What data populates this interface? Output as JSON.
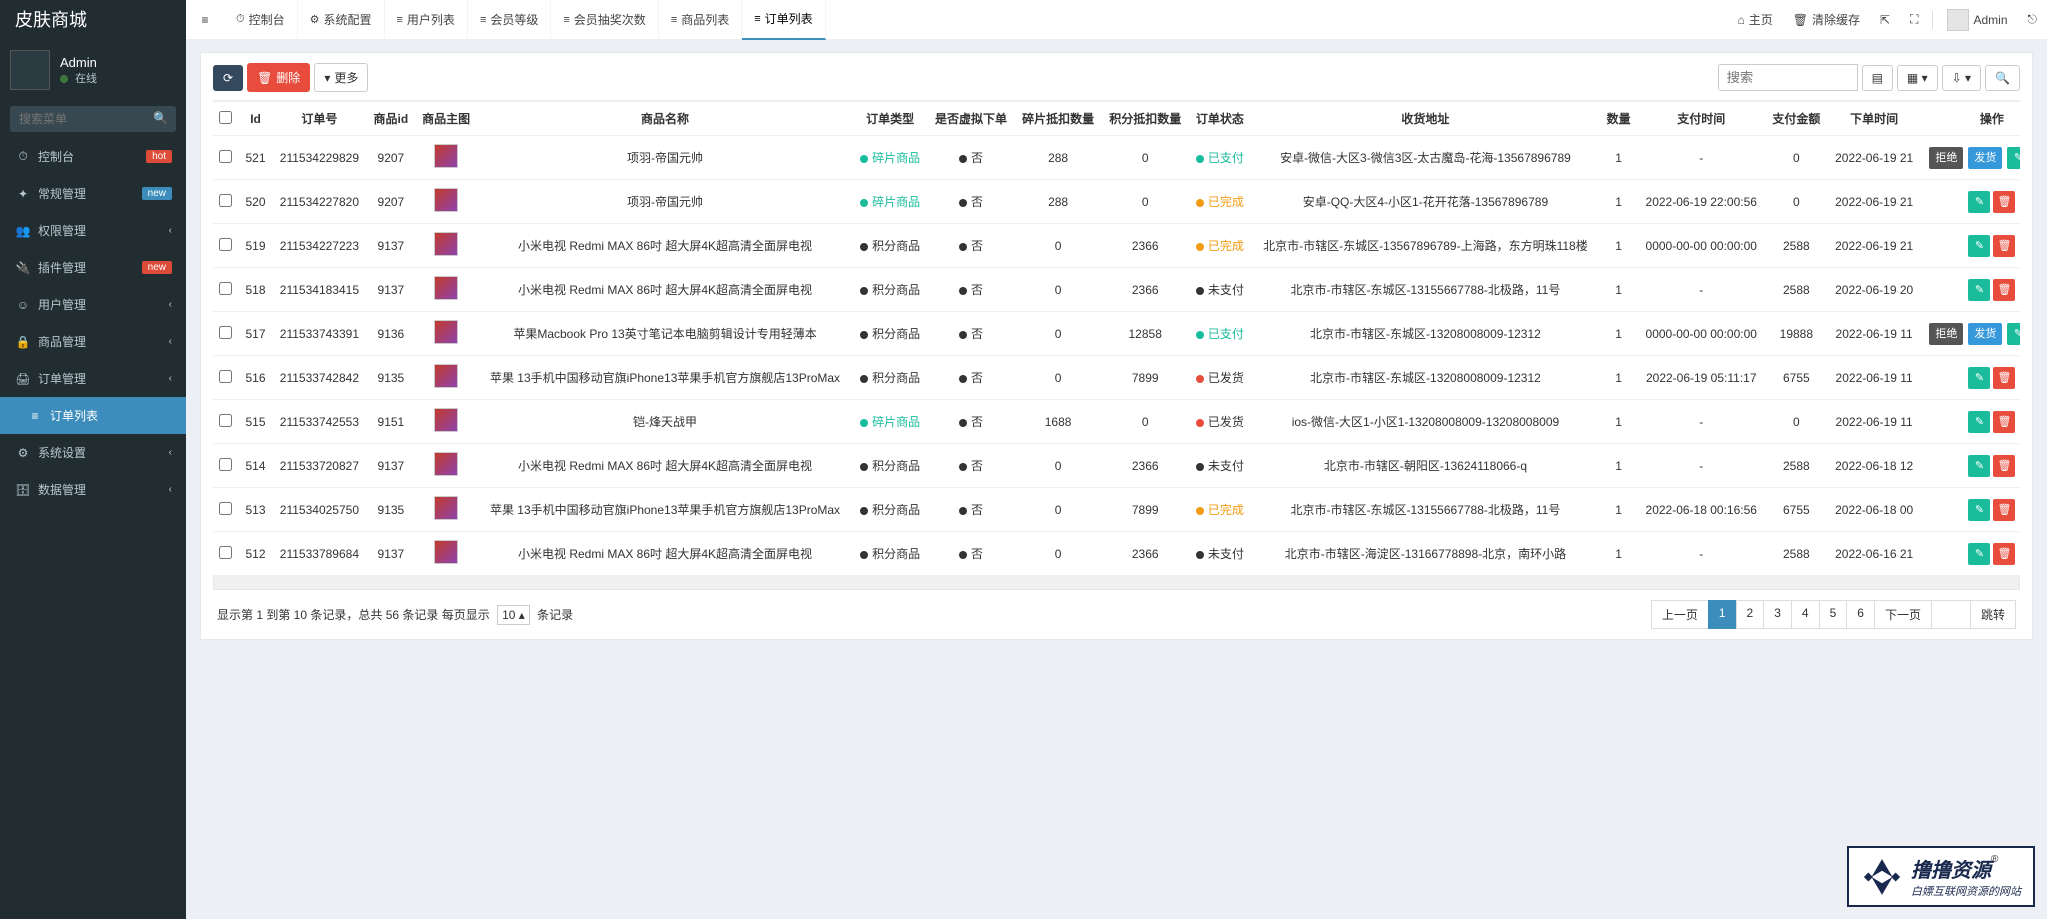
{
  "brand": "皮肤商城",
  "user": {
    "name": "Admin",
    "status": "在线"
  },
  "sidebar": {
    "search_placeholder": "搜索菜单",
    "items": [
      {
        "icon": "⏱",
        "label": "控制台",
        "badge": "hot",
        "badgeClass": "bdg-hot"
      },
      {
        "icon": "✦",
        "label": "常规管理",
        "badge": "new",
        "badgeClass": "bdg-new"
      },
      {
        "icon": "👥",
        "label": "权限管理",
        "caret": true
      },
      {
        "icon": "🔌",
        "label": "插件管理",
        "badge": "new",
        "badgeClass": "bdg-hot"
      },
      {
        "icon": "☺",
        "label": "用户管理",
        "caret": true
      },
      {
        "icon": "🔒",
        "label": "商品管理",
        "caret": true
      },
      {
        "icon": "🖨",
        "label": "订单管理",
        "caret": true,
        "sub": [
          {
            "icon": "≡",
            "label": "订单列表",
            "active": true
          }
        ]
      },
      {
        "icon": "⚙",
        "label": "系统设置",
        "caret": true
      },
      {
        "icon": "🗄",
        "label": "数据管理",
        "caret": true
      }
    ]
  },
  "tabs": [
    {
      "icon": "⏱",
      "label": "控制台"
    },
    {
      "icon": "⚙",
      "label": "系统配置"
    },
    {
      "icon": "≡",
      "label": "用户列表"
    },
    {
      "icon": "≡",
      "label": "会员等级"
    },
    {
      "icon": "≡",
      "label": "会员抽奖次数"
    },
    {
      "icon": "≡",
      "label": "商品列表"
    },
    {
      "icon": "≡",
      "label": "订单列表",
      "active": true
    }
  ],
  "topRight": {
    "home": "主页",
    "clear": "清除缓存",
    "admin": "Admin"
  },
  "toolbar": {
    "refresh": "⟳",
    "delete": "删除",
    "more": "更多",
    "search_placeholder": "搜索"
  },
  "columns": [
    "",
    "Id",
    "订单号",
    "商品id",
    "商品主图",
    "商品名称",
    "订单类型",
    "是否虚拟下单",
    "碎片抵扣数量",
    "积分抵扣数量",
    "订单状态",
    "收货地址",
    "数量",
    "支付时间",
    "支付金额",
    "下单时间",
    "操作"
  ],
  "orderTypes": {
    "frag": "碎片商品",
    "points": "积分商品"
  },
  "statuses": {
    "paid": {
      "label": "已支付",
      "dot": "dot-green",
      "txt": "txt-green"
    },
    "done": {
      "label": "已完成",
      "dot": "dot-orange",
      "txt": "txt-orange"
    },
    "unpaid": {
      "label": "未支付",
      "dot": "dot-black",
      "txt": "txt-black"
    },
    "shipped": {
      "label": "已发货",
      "dot": "dot-red",
      "txt": "txt-black"
    }
  },
  "actionTags": {
    "reject": "拒绝",
    "ship": "发货"
  },
  "noValue": "否",
  "dash": "-",
  "rows": [
    {
      "id": "521",
      "order": "211534229829",
      "gid": "9207",
      "name": "项羽-帝国元帅",
      "type": "frag",
      "virtual": "否",
      "frag": "288",
      "pts": "0",
      "status": "paid",
      "addr": "安卓-微信-大区3-微信3区-太古魔岛-花海-13567896789",
      "qty": "1",
      "paytime": "-",
      "payamt": "0",
      "ordertime": "2022-06-19 21",
      "tags": [
        "reject",
        "ship"
      ]
    },
    {
      "id": "520",
      "order": "211534227820",
      "gid": "9207",
      "name": "项羽-帝国元帅",
      "type": "frag",
      "virtual": "否",
      "frag": "288",
      "pts": "0",
      "status": "done",
      "addr": "安卓-QQ-大区4-小区1-花开花落-13567896789",
      "qty": "1",
      "paytime": "2022-06-19 22:00:56",
      "payamt": "0",
      "ordertime": "2022-06-19 21",
      "tags": []
    },
    {
      "id": "519",
      "order": "211534227223",
      "gid": "9137",
      "name": "小米电视 Redmi MAX 86吋 超大屏4K超高清全面屏电视",
      "type": "points",
      "virtual": "否",
      "frag": "0",
      "pts": "2366",
      "status": "done",
      "addr": "北京市-市辖区-东城区-13567896789-上海路，东方明珠118楼",
      "qty": "1",
      "paytime": "0000-00-00 00:00:00",
      "payamt": "2588",
      "ordertime": "2022-06-19 21",
      "tags": []
    },
    {
      "id": "518",
      "order": "211534183415",
      "gid": "9137",
      "name": "小米电视 Redmi MAX 86吋 超大屏4K超高清全面屏电视",
      "type": "points",
      "virtual": "否",
      "frag": "0",
      "pts": "2366",
      "status": "unpaid",
      "addr": "北京市-市辖区-东城区-13155667788-北极路，11号",
      "qty": "1",
      "paytime": "-",
      "payamt": "2588",
      "ordertime": "2022-06-19 20",
      "tags": []
    },
    {
      "id": "517",
      "order": "211533743391",
      "gid": "9136",
      "name": "苹果Macbook Pro 13英寸笔记本电脑剪辑设计专用轻薄本",
      "type": "points",
      "virtual": "否",
      "frag": "0",
      "pts": "12858",
      "status": "paid",
      "addr": "北京市-市辖区-东城区-13208008009-12312",
      "qty": "1",
      "paytime": "0000-00-00 00:00:00",
      "payamt": "19888",
      "ordertime": "2022-06-19 11",
      "tags": [
        "reject",
        "ship"
      ]
    },
    {
      "id": "516",
      "order": "211533742842",
      "gid": "9135",
      "name": "苹果 13手机中国移动官旗iPhone13苹果手机官方旗舰店13ProMax",
      "type": "points",
      "virtual": "否",
      "frag": "0",
      "pts": "7899",
      "status": "shipped",
      "addr": "北京市-市辖区-东城区-13208008009-12312",
      "qty": "1",
      "paytime": "2022-06-19 05:11:17",
      "payamt": "6755",
      "ordertime": "2022-06-19 11",
      "tags": []
    },
    {
      "id": "515",
      "order": "211533742553",
      "gid": "9151",
      "name": "铠-烽天战甲",
      "type": "frag",
      "virtual": "否",
      "frag": "1688",
      "pts": "0",
      "status": "shipped",
      "addr": "ios-微信-大区1-小区1-13208008009-13208008009",
      "qty": "1",
      "paytime": "-",
      "payamt": "0",
      "ordertime": "2022-06-19 11",
      "tags": []
    },
    {
      "id": "514",
      "order": "211533720827",
      "gid": "9137",
      "name": "小米电视 Redmi MAX 86吋 超大屏4K超高清全面屏电视",
      "type": "points",
      "virtual": "否",
      "frag": "0",
      "pts": "2366",
      "status": "unpaid",
      "addr": "北京市-市辖区-朝阳区-13624118066-q",
      "qty": "1",
      "paytime": "-",
      "payamt": "2588",
      "ordertime": "2022-06-18 12",
      "tags": []
    },
    {
      "id": "513",
      "order": "211534025750",
      "gid": "9135",
      "name": "苹果 13手机中国移动官旗iPhone13苹果手机官方旗舰店13ProMax",
      "type": "points",
      "virtual": "否",
      "frag": "0",
      "pts": "7899",
      "status": "done",
      "addr": "北京市-市辖区-东城区-13155667788-北极路，11号",
      "qty": "1",
      "paytime": "2022-06-18 00:16:56",
      "payamt": "6755",
      "ordertime": "2022-06-18 00",
      "tags": []
    },
    {
      "id": "512",
      "order": "211533789684",
      "gid": "9137",
      "name": "小米电视 Redmi MAX 86吋 超大屏4K超高清全面屏电视",
      "type": "points",
      "virtual": "否",
      "frag": "0",
      "pts": "2366",
      "status": "unpaid",
      "addr": "北京市-市辖区-海淀区-13166778898-北京，南环小路",
      "qty": "1",
      "paytime": "-",
      "payamt": "2588",
      "ordertime": "2022-06-16 21",
      "tags": []
    }
  ],
  "footer": {
    "info_prefix": "显示第 1 到第 10 条记录，总共 56 条记录 每页显示",
    "info_suffix": "条记录",
    "perpage": "10 ▴",
    "prev": "上一页",
    "next": "下一页",
    "jump": "跳转",
    "pages": [
      "1",
      "2",
      "3",
      "4",
      "5",
      "6"
    ],
    "active": "1"
  },
  "watermark": {
    "title": "撸撸资源",
    "subtitle": "白嫖互联网资源的网站"
  }
}
